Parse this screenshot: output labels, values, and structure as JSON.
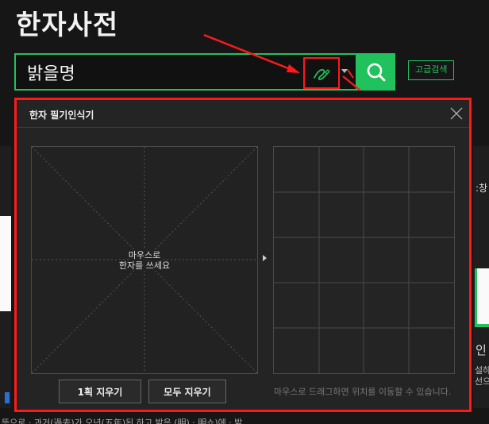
{
  "page": {
    "title": "한자사전"
  },
  "search": {
    "value": "밝을명",
    "advanced_label": "고급검색"
  },
  "icons": {
    "handwriting": "pen-handwriting-icon",
    "search": "magnifier-icon",
    "close": "close-x-icon",
    "caret": "triangle-down-icon"
  },
  "colors": {
    "accent_green": "#21c25e",
    "annotation_red": "#ff1a1a",
    "background": "#161616",
    "popup_bg": "#242424"
  },
  "popup": {
    "title": "한자 필기인식기",
    "canvas_hint_line1": "마우스로",
    "canvas_hint_line2": "한자를 쓰세요",
    "erase_one_label": "1획 지우기",
    "erase_all_label": "모두 지우기",
    "drag_hint": "마우스로 드래그하면 위치를 이동할 수 있습니다."
  },
  "background_fragments": {
    "right_text_1": ":창",
    "right_text_2": "인",
    "right_text_3": "설하",
    "right_text_4": "선으",
    "bottom_text": "뜻으로 · 과거(過去)가 오년(五年)된 하고 밝은 (明) · 明쇼)에 · 밝"
  }
}
